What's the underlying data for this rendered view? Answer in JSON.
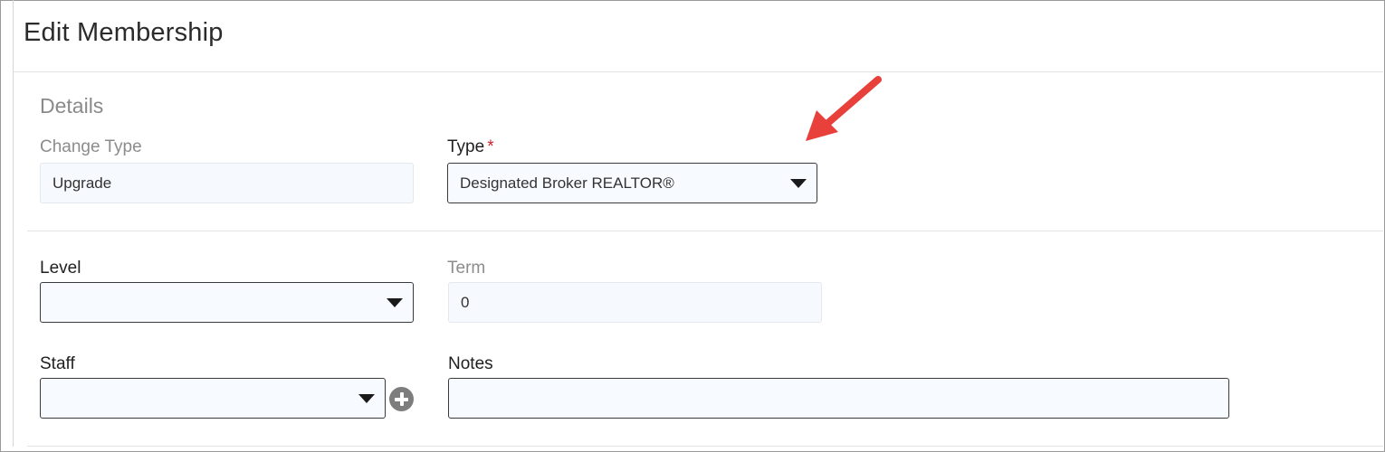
{
  "dialog": {
    "title": "Edit Membership",
    "section_title": "Details"
  },
  "fields": {
    "change_type": {
      "label": "Change Type",
      "value": "Upgrade"
    },
    "type": {
      "label": "Type",
      "required_mark": "*",
      "value": "Designated Broker REALTOR®"
    },
    "level": {
      "label": "Level",
      "value": ""
    },
    "term": {
      "label": "Term",
      "value": "0"
    },
    "staff": {
      "label": "Staff",
      "value": ""
    },
    "notes": {
      "label": "Notes",
      "value": ""
    }
  },
  "annotation": {
    "arrow_color": "#e8403a",
    "arrow_target": "type-select"
  },
  "icons": {
    "dropdown": "caret-down-icon",
    "add": "plus-circle-icon"
  }
}
